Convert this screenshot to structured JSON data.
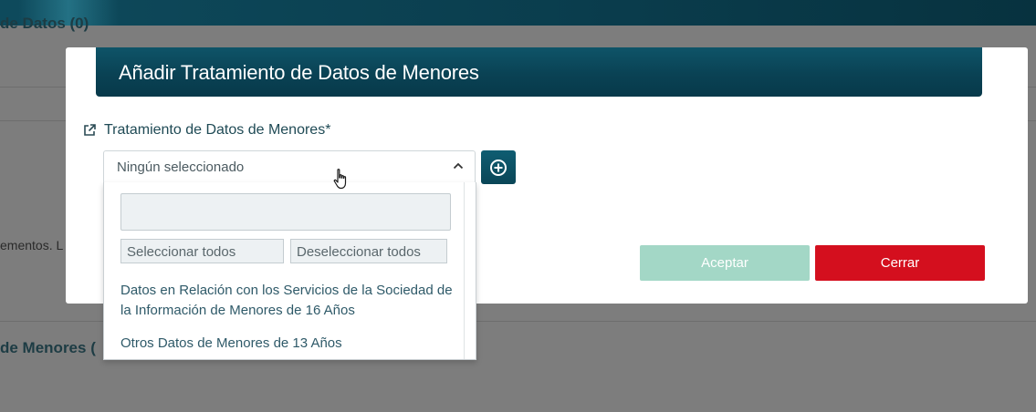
{
  "background": {
    "section_title_1": "de Datos (0)",
    "text_fragment": "ementos. L",
    "section_title_2": "de Menores ("
  },
  "modal": {
    "title": "Añadir Tratamiento de Datos de Menores",
    "field_label": "Tratamiento de Datos de Menores*",
    "select": {
      "value": "Ningún seleccionado",
      "search_placeholder": "",
      "select_all_label": "Seleccionar todos",
      "deselect_all_label": "Deseleccionar todos",
      "options": [
        "Datos en Relación con los Servicios de la Sociedad de la Información de Menores de 16 Años",
        "Otros Datos de Menores de 13 Años"
      ]
    },
    "accept_label": "Aceptar",
    "close_label": "Cerrar"
  },
  "colors": {
    "header": "#0a4254",
    "accept_disabled": "#a3d7c6",
    "close": "#d40f1e",
    "add_button": "#0f5d72"
  },
  "icons": {
    "field_link": "external-link-icon",
    "add": "plus-circle-icon",
    "select_toggle": "chevron-up-icon",
    "pointer": "hand-cursor-icon"
  }
}
